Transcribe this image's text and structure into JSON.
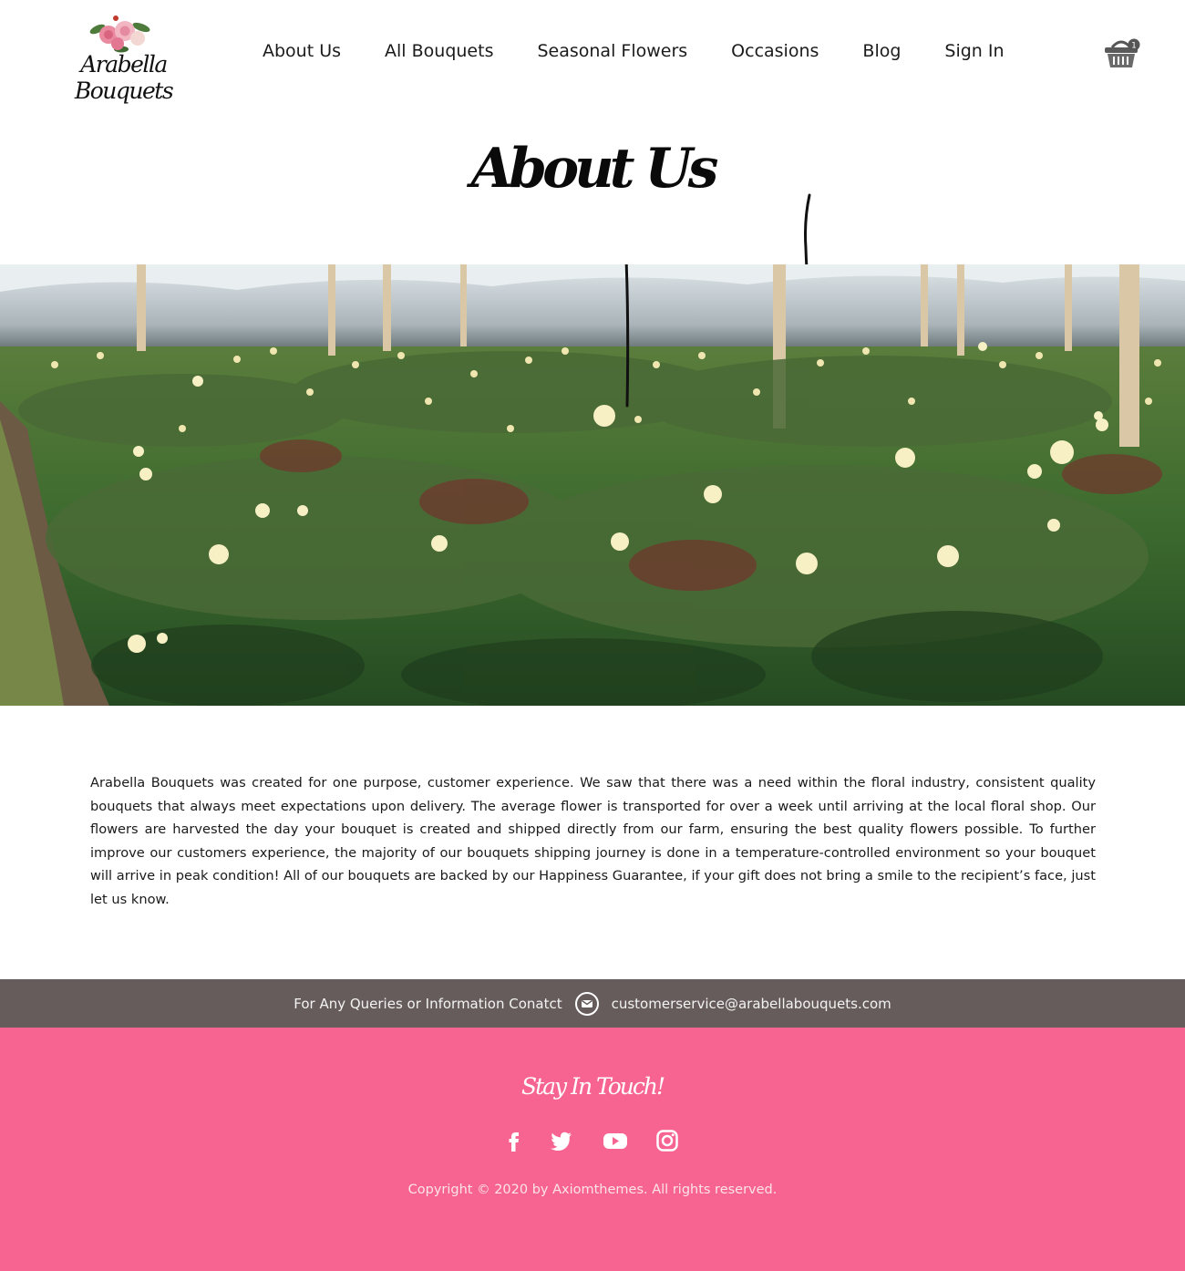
{
  "brand": {
    "name": "Arabella Bouquets"
  },
  "nav": {
    "items": [
      {
        "label": "About Us"
      },
      {
        "label": "All Bouquets"
      },
      {
        "label": "Seasonal Flowers"
      },
      {
        "label": "Occasions"
      },
      {
        "label": "Blog"
      },
      {
        "label": "Sign In"
      }
    ],
    "cart_icon": "basket-icon",
    "cart_count": "1"
  },
  "page": {
    "title": "About Us",
    "hero_image": "rose-greenhouse-photo",
    "body": "Arabella Bouquets was created for one purpose, customer experience. We saw that there was a need within the floral industry, consistent quality bouquets that always meet expectations upon delivery. The average flower is transported for over a week until arriving at the local floral shop. Our flowers are harvested the day your bouquet is created and shipped directly from our farm, ensuring the best quality flowers possible. To further improve our customers experience, the majority of our bouquets shipping journey is done in a temperature-controlled environment so your bouquet will arrive in peak condition! All of our bouquets are backed by our Happiness Guarantee, if your gift does not bring a smile to the recipient’s face, just let us know."
  },
  "contact": {
    "label": "For Any Queries or Information Conatct",
    "icon": "mail-icon",
    "email": "customerservice@arabellabouquets.com"
  },
  "footer": {
    "title": "Stay In Touch!",
    "social": [
      "facebook-icon",
      "twitter-icon",
      "youtube-icon",
      "instagram-icon"
    ],
    "copyright": "Copyright © 2020 by Axiomthemes. All rights reserved."
  },
  "colors": {
    "contact_bar": "#665c5b",
    "footer": "#f76491",
    "text": "#1a1a1a"
  }
}
